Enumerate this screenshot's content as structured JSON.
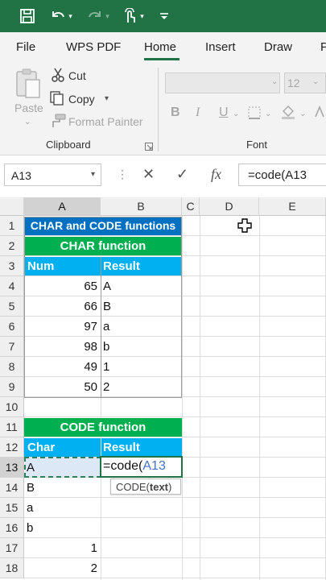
{
  "menu": {
    "tabs": [
      "File",
      "WPS PDF",
      "Home",
      "Insert",
      "Draw",
      "P"
    ]
  },
  "ribbon": {
    "paste": "Paste",
    "cut": "Cut",
    "copy": "Copy",
    "format_painter": "Format Painter",
    "clipboard_group": "Clipboard",
    "font_group": "Font",
    "font_size": "12",
    "bold": "B",
    "italic": "I",
    "underline": "U"
  },
  "formula_bar": {
    "name_box": "A13",
    "cancel": "✕",
    "enter": "✓",
    "fx": "fx",
    "formula": "=code(A13"
  },
  "columns": [
    "A",
    "B",
    "C",
    "D",
    "E"
  ],
  "rows": [
    "1",
    "2",
    "3",
    "4",
    "5",
    "6",
    "7",
    "8",
    "9",
    "10",
    "11",
    "12",
    "13",
    "14",
    "15",
    "16",
    "17",
    "18"
  ],
  "sheet": {
    "title": "CHAR and CODE functions",
    "char_header": "CHAR function",
    "num_label": "Num",
    "result_label": "Result",
    "char_rows": [
      {
        "num": "65",
        "result": "A"
      },
      {
        "num": "66",
        "result": "B"
      },
      {
        "num": "97",
        "result": "a"
      },
      {
        "num": "98",
        "result": "b"
      },
      {
        "num": "49",
        "result": "1"
      },
      {
        "num": "50",
        "result": "2"
      }
    ],
    "code_header": "CODE function",
    "char_label": "Char",
    "result2_label": "Result",
    "code_inputs": [
      "A",
      "B",
      "a",
      "b",
      "1",
      "2"
    ],
    "editing_prefix": "=code(",
    "editing_ref": "A13",
    "tooltip_fn": "CODE(",
    "tooltip_arg": "text",
    "tooltip_close": ")"
  },
  "colors": {
    "excel_green": "#217346",
    "title_blue": "#0070c0",
    "band_green": "#00b050",
    "header_blue": "#00b0f0",
    "ref_blue": "#4472c4"
  }
}
